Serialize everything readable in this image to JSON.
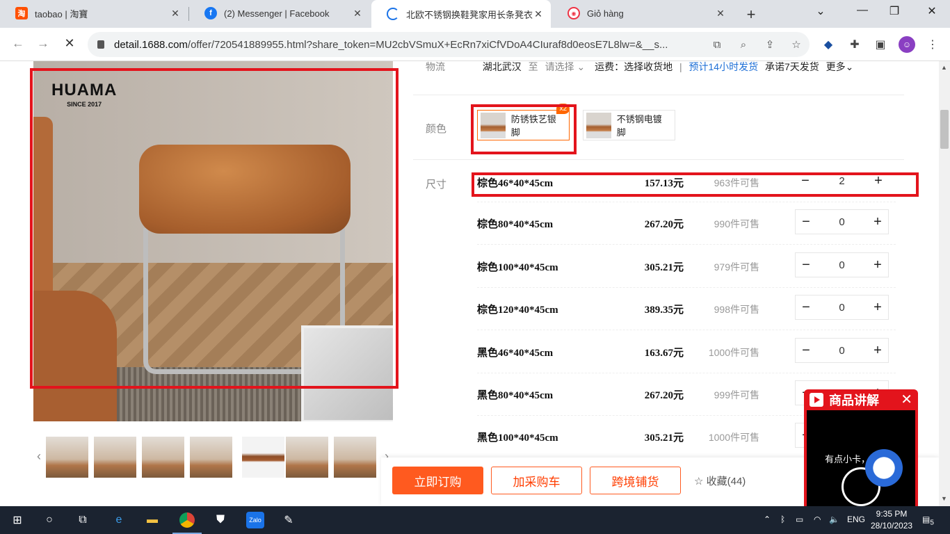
{
  "browser": {
    "tabs": [
      {
        "title": "taobao | 淘寶",
        "icon": "taobao-icon",
        "active": false
      },
      {
        "title": "(2) Messenger | Facebook",
        "icon": "facebook-icon",
        "active": false
      },
      {
        "title": "北欧不锈钢换鞋凳家用长条凳衣",
        "icon": "loading-icon",
        "active": true
      },
      {
        "title": "Giỏ hàng",
        "icon": "cart-site-icon",
        "active": false
      }
    ],
    "url_host": "detail.1688.com",
    "url_rest": "/offer/720541889955.html?share_token=MU2cbVSmuX+EcRn7xiCfVDoA4CIuraf8d0eosE7L8lw=&__s..."
  },
  "product": {
    "brand": "HUAMA",
    "brand_since": "SINCE 2017",
    "logistics": {
      "label": "物流",
      "from": "湖北武汉",
      "to_prefix": "至",
      "to_select": "请选择",
      "shipping": "运费：选择收货地",
      "eta": "预计14小时发货",
      "promise": "承诺7天发货",
      "more": "更多"
    },
    "color_label": "颜色",
    "colors": [
      {
        "name": "防锈铁艺银脚",
        "badge": "x2",
        "selected": true
      },
      {
        "name": "不锈钢电镀脚",
        "selected": false
      }
    ],
    "size_label": "尺寸",
    "skus": [
      {
        "name": "棕色46*40*45cm",
        "price": "157.13元",
        "stock": "963件可售",
        "qty": "2"
      },
      {
        "name": "棕色80*40*45cm",
        "price": "267.20元",
        "stock": "990件可售",
        "qty": "0"
      },
      {
        "name": "棕色100*40*45cm",
        "price": "305.21元",
        "stock": "979件可售",
        "qty": "0"
      },
      {
        "name": "棕色120*40*45cm",
        "price": "389.35元",
        "stock": "998件可售",
        "qty": "0"
      },
      {
        "name": "黑色46*40*45cm",
        "price": "163.67元",
        "stock": "1000件可售",
        "qty": "0"
      },
      {
        "name": "黑色80*40*45cm",
        "price": "267.20元",
        "stock": "999件可售",
        "qty": "0"
      },
      {
        "name": "黑色100*40*45cm",
        "price": "305.21元",
        "stock": "1000件可售",
        "qty": "0"
      }
    ]
  },
  "actions": {
    "buy_now": "立即订购",
    "add_cart": "加采购车",
    "cross_border": "跨境铺货",
    "favorite": "收藏(44)"
  },
  "live_popup": {
    "title": "商品讲解",
    "message": "有点小卡，"
  },
  "taskbar": {
    "lang": "ENG",
    "time": "9:35 PM",
    "date": "28/10/2023",
    "notifications": "5"
  }
}
